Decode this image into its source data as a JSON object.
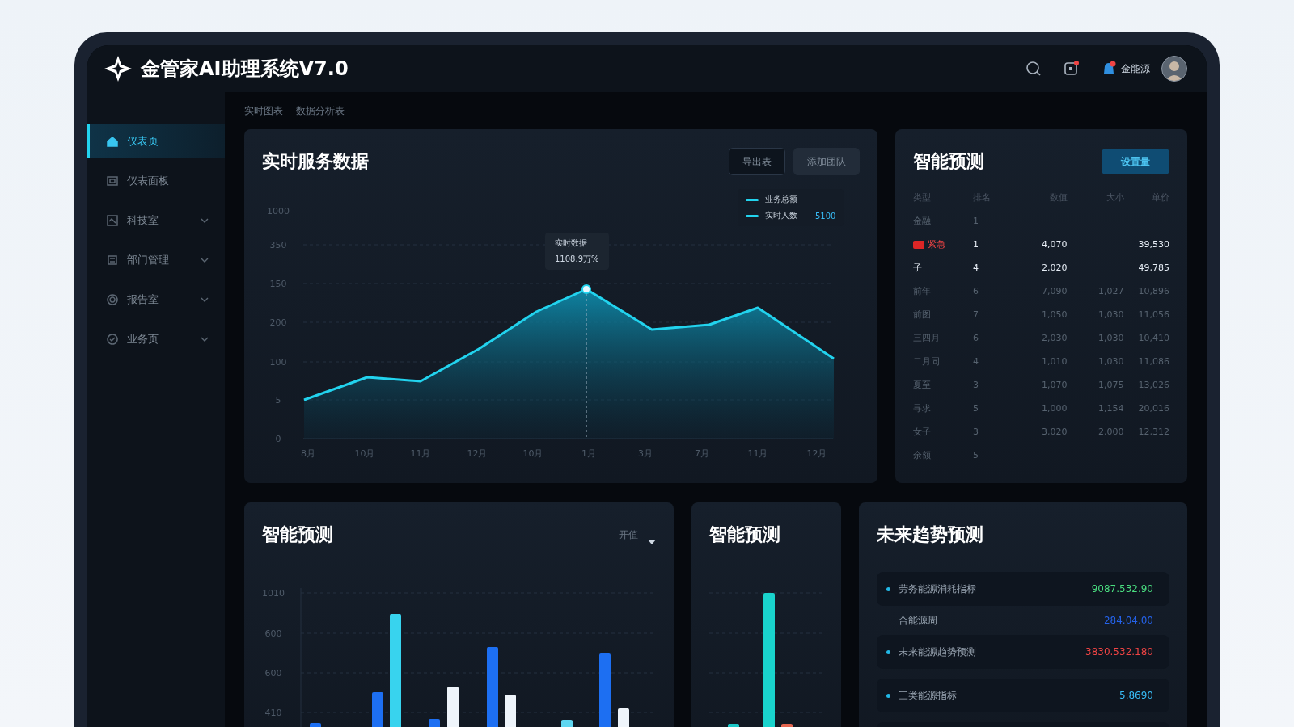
{
  "header": {
    "title": "金管家AI助理系统V7.0",
    "user_name": "金能源"
  },
  "sidebar": {
    "items": [
      {
        "label": "仪表页",
        "selected": true,
        "expandable": false
      },
      {
        "label": "仪表面板",
        "selected": false,
        "expandable": false
      },
      {
        "label": "科技室",
        "selected": false,
        "expandable": true
      },
      {
        "label": "部门管理",
        "selected": false,
        "expandable": true
      },
      {
        "label": "报告室",
        "selected": false,
        "expandable": true
      },
      {
        "label": "业务页",
        "selected": false,
        "expandable": true
      }
    ]
  },
  "breadcrumb": [
    "实时图表",
    "数据分析表"
  ],
  "realtime_card": {
    "title": "实时服务数据",
    "buttons": [
      {
        "label": "导出表",
        "kind": "outline"
      },
      {
        "label": "添加团队",
        "kind": "filled"
      }
    ],
    "legend": [
      {
        "label": "业务总额"
      },
      {
        "label": "实时人数",
        "value": "5100"
      }
    ],
    "tooltip": {
      "title": "实时数据",
      "value": "1108.9万%"
    },
    "y_axis_labels": [
      "1000",
      "350",
      "150",
      "200",
      "100",
      "5",
      "0"
    ],
    "x_axis_labels": [
      "8月",
      "10月",
      "11月",
      "12月",
      "10月",
      "1月",
      "3月",
      "7月",
      "11月",
      "12月"
    ]
  },
  "forecast_table": {
    "title": "智能预测",
    "button": "设置量",
    "columns": [
      "类型",
      "排名",
      "数值",
      "大小",
      "单价"
    ],
    "rows": [
      {
        "cells": [
          "金融",
          "1",
          "",
          "",
          ""
        ],
        "highlighted": false,
        "flagged": false
      },
      {
        "cells": [
          "紧急",
          "1",
          "4,070",
          "",
          "39,530"
        ],
        "highlighted": true,
        "flagged": true
      },
      {
        "cells": [
          "子",
          "4",
          "2,020",
          "",
          "49,785"
        ],
        "highlighted": true,
        "flagged": false
      },
      {
        "cells": [
          "前年",
          "6",
          "7,090",
          "1,027",
          "10,896"
        ],
        "highlighted": false,
        "flagged": false
      },
      {
        "cells": [
          "前图",
          "7",
          "1,050",
          "1,030",
          "11,056"
        ],
        "highlighted": false,
        "flagged": false
      },
      {
        "cells": [
          "三四月",
          "6",
          "2,030",
          "1,030",
          "10,410"
        ],
        "highlighted": false,
        "flagged": false
      },
      {
        "cells": [
          "二月同",
          "4",
          "1,010",
          "1,030",
          "11,086"
        ],
        "highlighted": false,
        "flagged": false
      },
      {
        "cells": [
          "夏至",
          "3",
          "1,070",
          "1,075",
          "13,026"
        ],
        "highlighted": false,
        "flagged": false
      },
      {
        "cells": [
          "寻求",
          "5",
          "1,000",
          "1,154",
          "20,016"
        ],
        "highlighted": false,
        "flagged": false
      },
      {
        "cells": [
          "女子",
          "3",
          "3,020",
          "2,000",
          "12,312"
        ],
        "highlighted": false,
        "flagged": false
      },
      {
        "cells": [
          "余额",
          "5",
          "",
          "",
          ""
        ],
        "highlighted": false,
        "flagged": false
      }
    ]
  },
  "bar_card": {
    "title": "智能预测",
    "dropdown": "开值",
    "y_axis_labels": [
      "1010",
      "600",
      "600",
      "410"
    ]
  },
  "small_bar_card": {
    "title": "智能预测"
  },
  "trend_card": {
    "title": "未来趋势预测",
    "rows": [
      {
        "label": "劳务能源消耗指标",
        "value": "9087.532.90",
        "color": "#4ade80",
        "dot": true,
        "boxed": true
      },
      {
        "label": "合能源周",
        "value": "284.04.00",
        "color": "#2563eb",
        "dot": false,
        "boxed": false
      },
      {
        "label": "未来能源趋势预测",
        "value": "3830.532.180",
        "color": "#ef4444",
        "dot": true,
        "boxed": true
      },
      {
        "label": "三类能源指标",
        "value": "5.8690",
        "color": "#38bdf8",
        "dot": true,
        "boxed": true
      }
    ]
  }
}
